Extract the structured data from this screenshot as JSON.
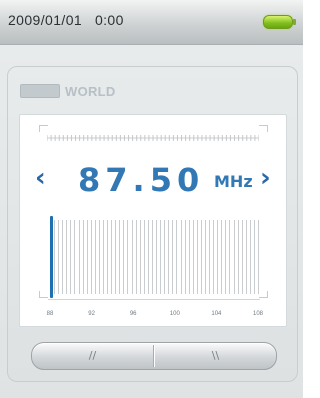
{
  "status": {
    "date": "2009/01/01",
    "time": "0:00",
    "battery_icon": "battery-full-icon",
    "battery_color": "#8fcd22"
  },
  "radio": {
    "band_badge": "",
    "band": "WORLD",
    "frequency": "87.50",
    "unit": "MHz",
    "prev_arrow": "‹",
    "next_arrow": "›",
    "accent_color": "#3278b5"
  },
  "scale": {
    "tick_labels": [
      "88",
      "92",
      "96",
      "100",
      "104",
      "108"
    ],
    "range_mhz": [
      87.5,
      108
    ],
    "current_mhz": 87.5
  },
  "buttons": {
    "left_icon": "seek-back-icon",
    "left_label": "//",
    "right_icon": "seek-forward-icon",
    "right_label": "\\\\"
  }
}
